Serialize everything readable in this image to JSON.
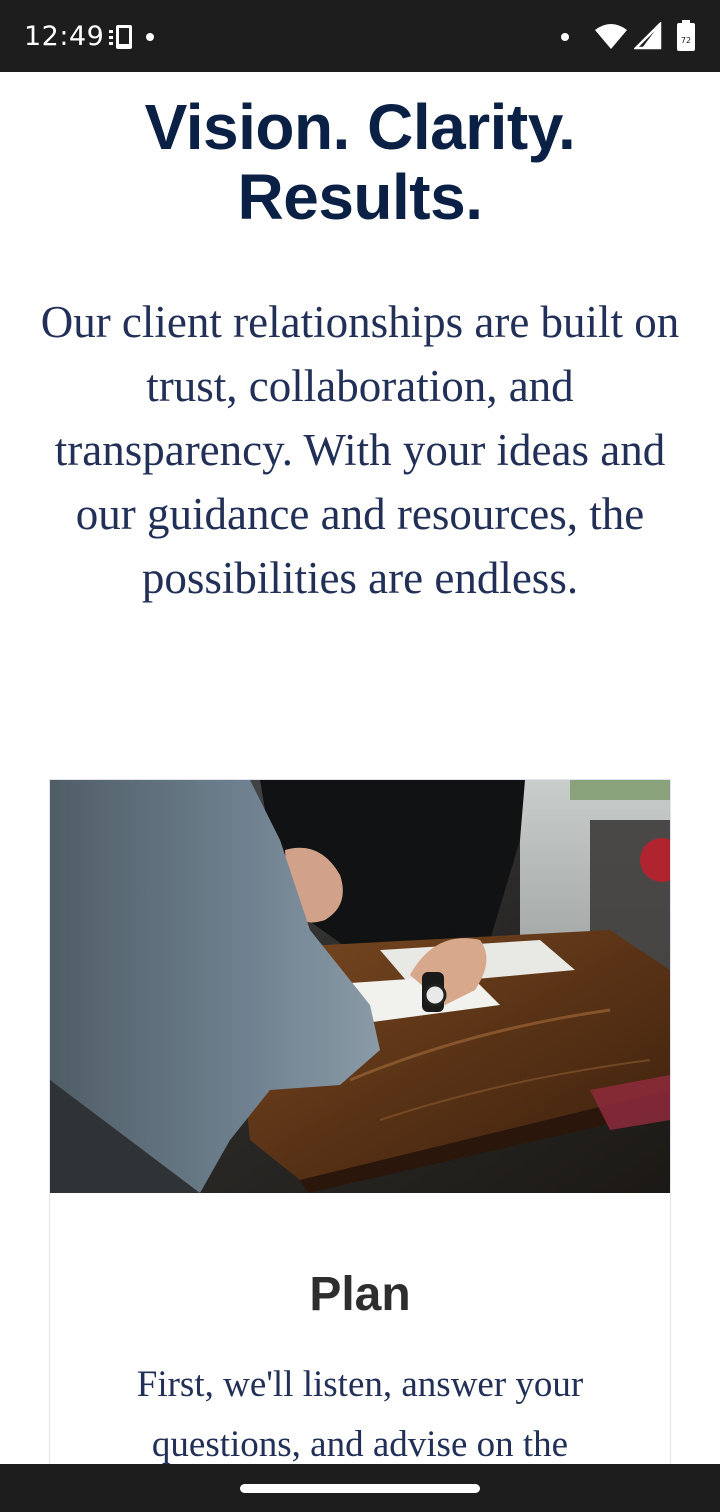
{
  "status_bar": {
    "time": "12:49",
    "icons": [
      "phone-vibrate-icon",
      "notification-dot-icon",
      "wifi-icon",
      "cell-signal-icon",
      "battery-icon"
    ],
    "battery_level": "72"
  },
  "hero": {
    "title": "Vision. Clarity. Results.",
    "text": "Our client relationships are built on trust, collaboration, and transparency. With your ideas and our guidance and resources, the possibilities are endless."
  },
  "card": {
    "title": "Plan",
    "text": "First, we'll listen, answer your questions, and advise on the"
  },
  "colors": {
    "heading": "#0b2045",
    "body_text": "#223058",
    "card_title": "#2e2e2e",
    "status_bar": "#1d1d1d"
  }
}
